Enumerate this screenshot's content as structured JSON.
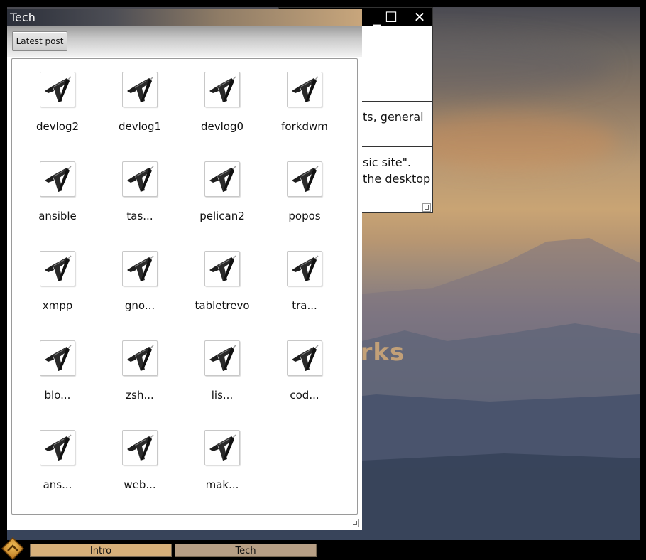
{
  "desktop": {
    "headline": "ll it works"
  },
  "background_window": {
    "minimize_glyph": "_",
    "maximize_glyph": "☐",
    "close_glyph": "✕",
    "text_line_1": "ts, general",
    "text_line_2": "sic site\".",
    "text_line_3": "the desktop"
  },
  "main_window": {
    "title": "Tech",
    "titlebar_controls": {
      "minimize_glyph": "_",
      "maximize_glyph": "☐",
      "close_glyph": "✕"
    },
    "toolbar": {
      "latest_post_label": "Latest post"
    },
    "items": [
      {
        "label": "devlog2",
        "icon": "document-icon"
      },
      {
        "label": "devlog1",
        "icon": "document-icon"
      },
      {
        "label": "devlog0",
        "icon": "document-icon"
      },
      {
        "label": "forkdwm",
        "icon": "document-icon"
      },
      {
        "label": "ansible",
        "icon": "document-icon"
      },
      {
        "label": "tas...",
        "icon": "document-icon"
      },
      {
        "label": "pelican2",
        "icon": "document-icon"
      },
      {
        "label": "popos",
        "icon": "document-icon"
      },
      {
        "label": "xmpp",
        "icon": "document-icon"
      },
      {
        "label": "gno...",
        "icon": "document-icon"
      },
      {
        "label": "tabletrevo",
        "icon": "document-icon"
      },
      {
        "label": "tra...",
        "icon": "document-icon"
      },
      {
        "label": "blo...",
        "icon": "document-icon"
      },
      {
        "label": "zsh...",
        "icon": "document-icon"
      },
      {
        "label": "lis...",
        "icon": "document-icon"
      },
      {
        "label": "cod...",
        "icon": "document-icon"
      },
      {
        "label": "ans...",
        "icon": "document-icon"
      },
      {
        "label": "web...",
        "icon": "document-icon"
      },
      {
        "label": "mak...",
        "icon": "document-icon"
      }
    ]
  },
  "taskbar": {
    "start_icon": "start-menu-icon",
    "tasks": [
      {
        "label": "Intro",
        "active": false
      },
      {
        "label": "Tech",
        "active": true
      }
    ]
  },
  "colors": {
    "titlebar_accent": "#c8a67c",
    "task_button": "#d7b07a",
    "task_button_active": "#b79f85"
  }
}
